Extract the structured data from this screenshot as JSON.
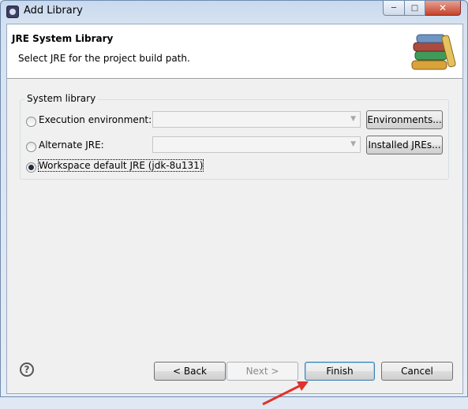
{
  "window": {
    "title": "Add Library",
    "controls": {
      "minimize": "─",
      "maximize": "□",
      "close": "✕"
    }
  },
  "header": {
    "title": "JRE System Library",
    "description": "Select JRE for the project build path.",
    "icon": "library-books-icon"
  },
  "group": {
    "label": "System library",
    "options": [
      {
        "label": "Execution environment:",
        "selected": false
      },
      {
        "label": "Alternate JRE:",
        "selected": false
      },
      {
        "label": "Workspace default JRE (jdk-8u131)",
        "selected": true
      }
    ],
    "execution_environment_value": "",
    "alternate_jre_value": "",
    "environments_button": "Environments...",
    "installed_jres_button": "Installed JREs..."
  },
  "footer": {
    "help_icon": "?",
    "back_button": "< Back",
    "next_button": "Next >",
    "finish_button": "Finish",
    "cancel_button": "Cancel"
  },
  "colors": {
    "annotation_arrow": "#e0332b",
    "default_button_border": "#3c7fb1"
  }
}
